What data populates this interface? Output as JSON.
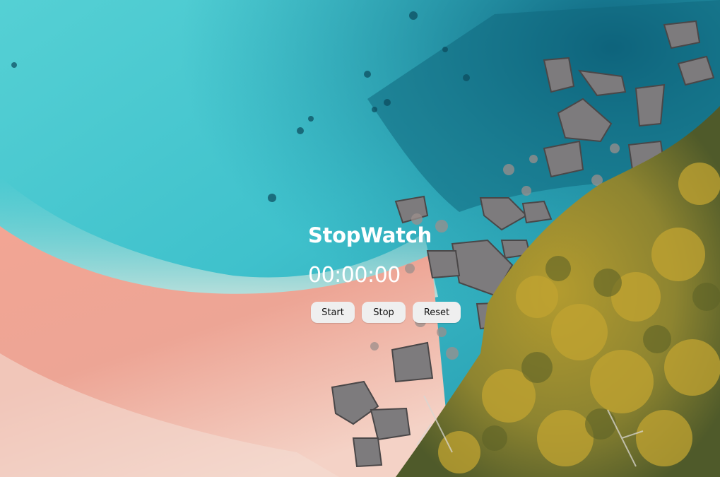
{
  "background": {
    "icon": "beach-aerial-photo"
  },
  "stopwatch": {
    "title": "StopWatch",
    "time": "00:00:00",
    "buttons": {
      "start": "Start",
      "stop": "Stop",
      "reset": "Reset"
    }
  },
  "colors": {
    "text": "#ffffff",
    "button_bg": "#efefef",
    "water": "#3fc4cf",
    "sand": "#efad98",
    "foliage": "#9a8b2c"
  }
}
